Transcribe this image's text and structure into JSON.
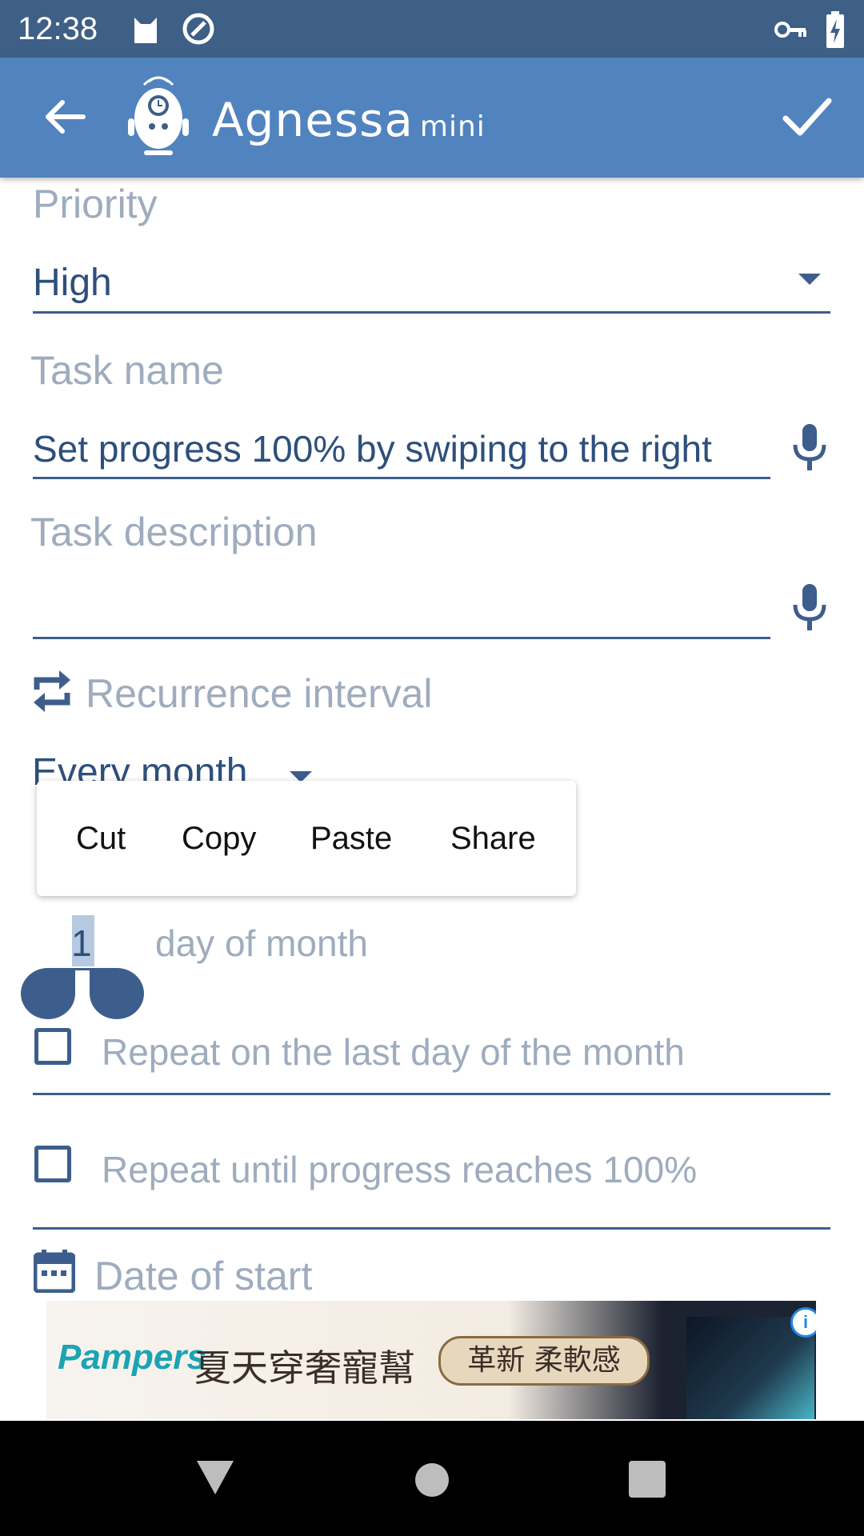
{
  "status_bar": {
    "time": "12:38",
    "icons": [
      "cat-notification-icon",
      "sync-icon",
      "vpn-key-icon",
      "battery-charging-icon"
    ]
  },
  "app_bar": {
    "title": "Agnessa",
    "title_suffix": "mini",
    "back_icon": "arrow-back-icon",
    "confirm_icon": "check-icon"
  },
  "form": {
    "priority": {
      "label": "Priority",
      "value": "High"
    },
    "task_name": {
      "label": "Task name",
      "value": "Set progress 100% by swiping to the right"
    },
    "task_description": {
      "label": "Task description",
      "value": ""
    },
    "recurrence": {
      "label": "Recurrence interval",
      "value": "Every month"
    },
    "day_of_month": {
      "value": "1",
      "label": "day of month"
    },
    "repeat_last_day": {
      "label": "Repeat on the last day of the month",
      "checked": false
    },
    "repeat_until_progress": {
      "label": "Repeat until progress reaches 100%",
      "checked": false
    },
    "date_of_start": {
      "label": "Date of start"
    }
  },
  "context_menu": {
    "items": [
      "Cut",
      "Copy",
      "Paste",
      "Share"
    ]
  },
  "ad": {
    "brand": "Pampers",
    "headline": "夏天穿奢寵幫",
    "pill": "革新 柔軟感"
  },
  "colors": {
    "status_bar": "#3e5f86",
    "app_bar": "#5183bf",
    "primary": "#3d5e8c",
    "hint": "#9eacbd"
  }
}
